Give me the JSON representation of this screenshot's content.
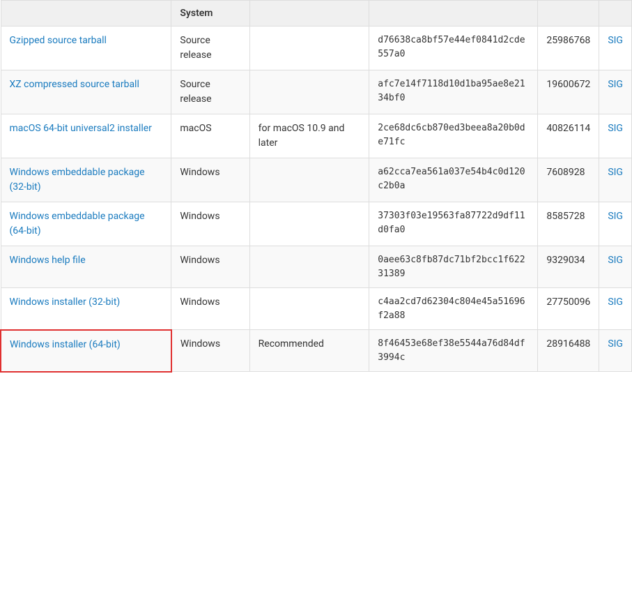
{
  "table": {
    "headers": [
      "",
      "System",
      "",
      "",
      "",
      ""
    ],
    "header_labels": {
      "col0": "",
      "col1": "System",
      "col2": "",
      "col3": "",
      "col4": "",
      "col5": ""
    },
    "rows": [
      {
        "id": "row-gzipped",
        "link_text": "Gzipped source tarball",
        "system": "Source release",
        "note": "",
        "hash": "d76638ca8bf57e44ef0841d2cde557a0",
        "size": "25986768",
        "sig": "SIG",
        "highlighted": false
      },
      {
        "id": "row-xz",
        "link_text": "XZ compressed source tarball",
        "system": "Source release",
        "note": "",
        "hash": "afc7e14f7118d10d1ba95ae8e2134bf0",
        "size": "19600672",
        "sig": "SIG",
        "highlighted": false
      },
      {
        "id": "row-macos",
        "link_text": "macOS 64-bit universal2 installer",
        "system": "macOS",
        "note": "for macOS 10.9 and later",
        "hash": "2ce68dc6cb870ed3beea8a20b0de71fc",
        "size": "40826114",
        "sig": "SIG",
        "highlighted": false
      },
      {
        "id": "row-win-emb-32",
        "link_text": "Windows embeddable package (32-bit)",
        "system": "Windows",
        "note": "",
        "hash": "a62cca7ea561a037e54b4c0d120c2b0a",
        "size": "7608928",
        "sig": "SIG",
        "highlighted": false
      },
      {
        "id": "row-win-emb-64",
        "link_text": "Windows embeddable package (64-bit)",
        "system": "Windows",
        "note": "",
        "hash": "37303f03e19563fa87722d9df11d0fa0",
        "size": "8585728",
        "sig": "SIG",
        "highlighted": false
      },
      {
        "id": "row-win-help",
        "link_text": "Windows help file",
        "system": "Windows",
        "note": "",
        "hash": "0aee63c8fb87dc71bf2bcc1f62231389",
        "size": "9329034",
        "sig": "SIG",
        "highlighted": false
      },
      {
        "id": "row-win-inst-32",
        "link_text": "Windows installer (32-bit)",
        "system": "Windows",
        "note": "",
        "hash": "c4aa2cd7d62304c804e45a51696f2a88",
        "size": "27750096",
        "sig": "SIG",
        "highlighted": false
      },
      {
        "id": "row-win-inst-64",
        "link_text": "Windows installer (64-bit)",
        "system": "Windows",
        "note": "Recommended",
        "hash": "8f46453e68ef38e5544a76d84df3994c",
        "size": "28916488",
        "sig": "SIG",
        "highlighted": true
      }
    ]
  }
}
